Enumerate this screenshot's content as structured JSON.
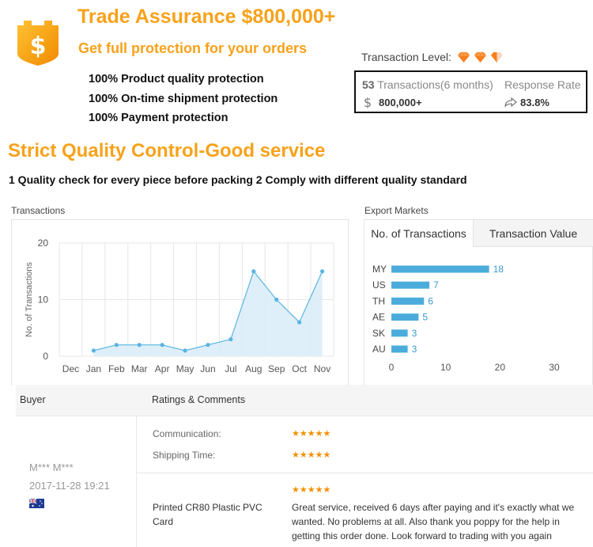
{
  "header": {
    "title": "Trade Assurance $800,000+",
    "subtitle": "Get full protection for your orders",
    "protections": [
      "100% Product quality protection",
      "100% On-time shipment protection",
      "100% Payment protection"
    ]
  },
  "transaction_level": {
    "label": "Transaction Level:",
    "level_diamonds": 2.5
  },
  "stats": {
    "count": "53",
    "count_label": "Transactions(6 months)",
    "response_label": "Response Rate",
    "value": "800,000+",
    "response_rate": "83.8%"
  },
  "quality": {
    "heading": "Strict Quality Control-Good service",
    "line": "1 Quality check for every piece before packing 2 Comply with different quality standard"
  },
  "transactions_chart": {
    "section_label": "Transactions",
    "ylabel": "No. of Transactions",
    "y_ticks": [
      "0",
      "10",
      "20"
    ],
    "months": [
      "Dec",
      "Jan",
      "Feb",
      "Mar",
      "Apr",
      "May",
      "Jun",
      "Jul",
      "Aug",
      "Sep",
      "Oct",
      "Nov"
    ],
    "colors": {
      "line": "#5ab4e2",
      "fill": "#d8ecf8",
      "grid": "#e6e6e6"
    }
  },
  "export_markets": {
    "section_label": "Export Markets",
    "tabs": [
      "No. of Transactions",
      "Transaction Value"
    ],
    "x_ticks": [
      "0",
      "10",
      "20",
      "30"
    ],
    "bar_color": "#4bacdc"
  },
  "chart_data": [
    {
      "type": "area",
      "title": "",
      "xlabel": "",
      "ylabel": "No. of Transactions",
      "x": [
        "Dec",
        "Jan",
        "Feb",
        "Mar",
        "Apr",
        "May",
        "Jun",
        "Jul",
        "Aug",
        "Sep",
        "Oct",
        "Nov"
      ],
      "values": [
        null,
        1,
        2,
        2,
        2,
        1,
        2,
        3,
        15,
        10,
        6,
        15
      ],
      "ylim": [
        0,
        20
      ],
      "grid": true
    },
    {
      "type": "bar",
      "orientation": "horizontal",
      "categories": [
        "MY",
        "US",
        "TH",
        "AE",
        "SK",
        "AU"
      ],
      "values": [
        18,
        7,
        6,
        5,
        3,
        3
      ],
      "xlim": [
        0,
        30
      ],
      "grid": false
    }
  ],
  "reviews": {
    "headers": {
      "buyer": "Buyer",
      "ratings": "Ratings & Comments"
    },
    "items": [
      {
        "buyer": "M*** M***",
        "date": "2017-11-28 19:21",
        "flag": "AU",
        "communication_label": "Communication:",
        "communication_stars": 5,
        "shipping_label": "Shipping Time:",
        "shipping_stars": 5,
        "rating_stars": 5,
        "product": "Printed CR80 Plastic PVC Card",
        "comment": "Great service, received 6 days after paying and it's exactly what we wanted. No problems at all. Also thank you poppy for the help in getting this order done. Look forward to trading with you again"
      }
    ]
  }
}
